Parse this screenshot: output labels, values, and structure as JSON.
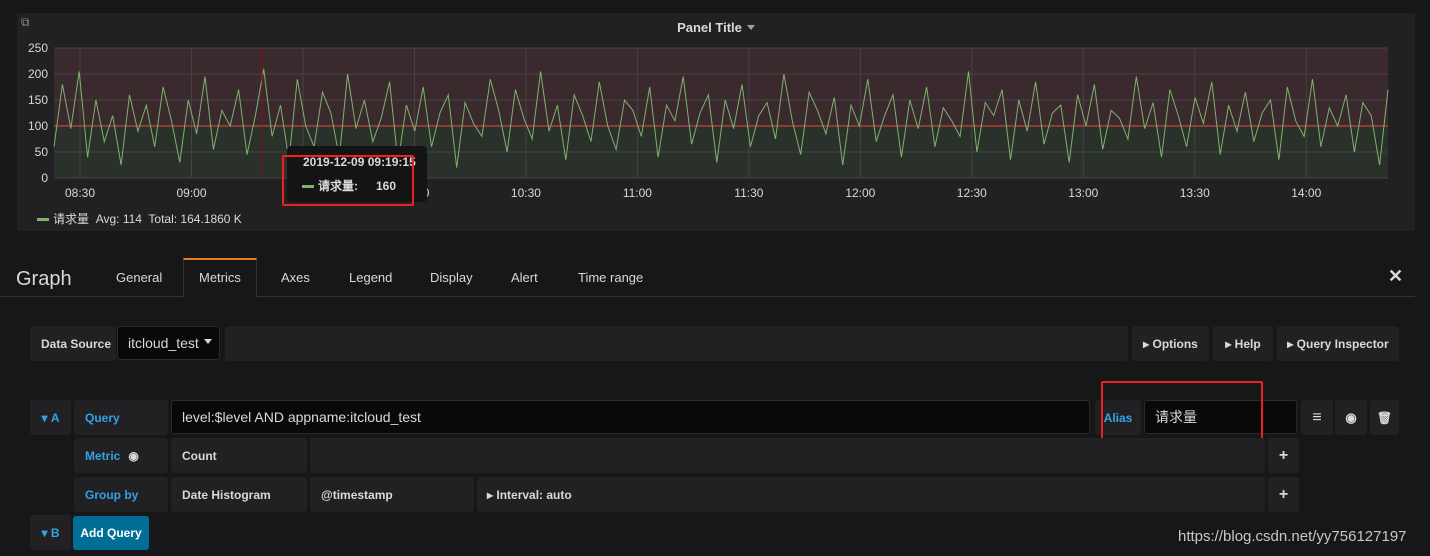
{
  "panel": {
    "title": "Panel Title",
    "corner_icon": "external-link-icon"
  },
  "chart_data": {
    "type": "line",
    "title": "",
    "xlabel": "",
    "ylabel": "",
    "ylim": [
      0,
      250
    ],
    "yticks": [
      "0",
      "50",
      "100",
      "150",
      "200",
      "250"
    ],
    "xticks": [
      "08:30",
      "09:00",
      "09:30",
      "10:00",
      "10:30",
      "11:00",
      "11:30",
      "12:00",
      "12:30",
      "13:00",
      "13:30",
      "14:00"
    ],
    "x_range": [
      "08:23",
      "14:22"
    ],
    "grid": true,
    "thresholds": [
      {
        "value": 100,
        "op": "gt",
        "color": "#e24d42"
      }
    ],
    "series": [
      {
        "name": "请求量",
        "color": "#7eb26d",
        "values": [
          60,
          180,
          95,
          205,
          40,
          150,
          70,
          120,
          25,
          160,
          90,
          140,
          60,
          175,
          110,
          30,
          150,
          85,
          195,
          55,
          130,
          100,
          170,
          45,
          120,
          210,
          80,
          140,
          35,
          190,
          100,
          60,
          165,
          125,
          40,
          200,
          95,
          150,
          70,
          115,
          185,
          30,
          140,
          90,
          175,
          60,
          125,
          160,
          20,
          145,
          105,
          80,
          190,
          130,
          50,
          170,
          115,
          75,
          205,
          90,
          140,
          35,
          160,
          120,
          70,
          185,
          100,
          55,
          150,
          130,
          80,
          175,
          40,
          140,
          110,
          195,
          65,
          125,
          160,
          30,
          150,
          95,
          180,
          60,
          120,
          145,
          75,
          200,
          110,
          45,
          165,
          130,
          85,
          155,
          25,
          140,
          100,
          190,
          70,
          120,
          160,
          40,
          150,
          95,
          175,
          60,
          135,
          110,
          80,
          205,
          50,
          145,
          120,
          170,
          35,
          150,
          90,
          185,
          65,
          125,
          140,
          30,
          160,
          100,
          180,
          55,
          130,
          115,
          75,
          195,
          95,
          145,
          40,
          170,
          120,
          60,
          155,
          105,
          185,
          45,
          140,
          90,
          165,
          70,
          125,
          150,
          35,
          175,
          110,
          80,
          190,
          60,
          135,
          100,
          160,
          50,
          145,
          120,
          25,
          170
        ]
      }
    ]
  },
  "tooltip": {
    "time": "2019-12-09 09:19:15",
    "series": "请求量:",
    "value": "160"
  },
  "legend": {
    "name": "请求量",
    "avg": "Avg: 114",
    "total": "Total: 164.1860 K"
  },
  "editor": {
    "title": "Graph",
    "tabs": [
      "General",
      "Metrics",
      "Axes",
      "Legend",
      "Display",
      "Alert",
      "Time range"
    ],
    "active_tab": "Metrics",
    "close_icon": "close-icon"
  },
  "datasource": {
    "label": "Data Source",
    "value": "itcloud_test",
    "options": "Options",
    "help": "Help",
    "inspector": "Query Inspector"
  },
  "query": {
    "letter": "A",
    "query_label": "Query",
    "query_value": "level:$level AND appname:itcloud_test",
    "alias_label": "Alias",
    "alias_value": "请求量",
    "metric_label": "Metric",
    "metric_value": "Count",
    "group_label": "Group by",
    "group_value": "Date Histogram",
    "group_field": "@timestamp",
    "interval": "Interval: auto"
  },
  "query_b": {
    "letter": "B",
    "add_label": "Add Query"
  },
  "watermark": "https://blog.csdn.net/yy756127197"
}
